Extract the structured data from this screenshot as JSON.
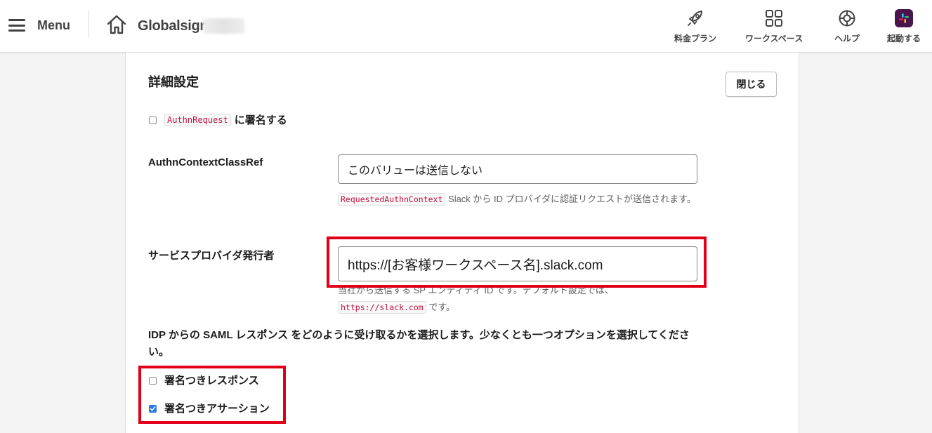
{
  "header": {
    "menu_label": "Menu",
    "workspace_name": "Globalsign",
    "nav": [
      {
        "label": "料金プラン",
        "icon": "rocket-icon"
      },
      {
        "label": "ワークスペース",
        "icon": "grid-icon"
      },
      {
        "label": "ヘルプ",
        "icon": "lifebuoy-icon"
      },
      {
        "label": "起動する",
        "icon": "slack-logo-icon"
      }
    ]
  },
  "panel": {
    "title": "詳細設定",
    "close_label": "閉じる",
    "authn_request": {
      "code": "AuthnRequest",
      "label": "に署名する",
      "checked": false
    },
    "authn_context": {
      "label": "AuthnContextClassRef",
      "value": "このバリューは送信しない",
      "hint_code": "RequestedAuthnContext",
      "hint_text": " Slack から ID プロバイダに認証リクエストが送信されます。"
    },
    "sp_issuer": {
      "label": "サービスプロバイダ発行者",
      "value": "https://[お客様ワークスペース名].slack.com",
      "hint_text": "当社から送信する SP エンティティ ID です。デフォルト設定では、",
      "hint_code": "https://slack.com",
      "hint_suffix": " です。"
    },
    "saml_prompt": "IDP からの SAML レスポンス をどのように受け取るかを選択します。少なくとも一つオプションを選択してください。",
    "options": [
      {
        "label": "署名つきレスポンス",
        "checked": false
      },
      {
        "label": "署名つきアサーション",
        "checked": true
      }
    ]
  },
  "colors": {
    "highlight": "#e0001a",
    "checkbox_checked": "#2b78e4",
    "code_text": "#c01343"
  }
}
